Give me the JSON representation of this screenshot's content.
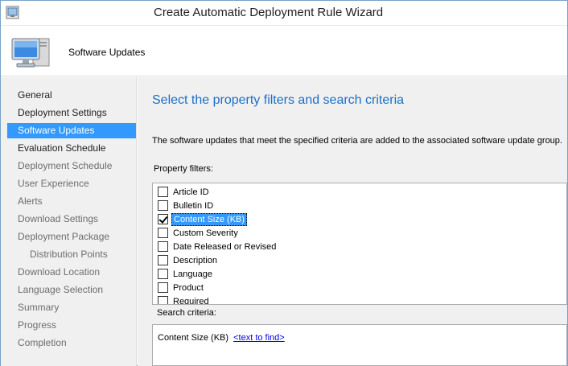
{
  "window": {
    "title": "Create Automatic Deployment Rule Wizard"
  },
  "header": {
    "title": "Software Updates",
    "icon": "computer-monitor-icon"
  },
  "sidebar": {
    "items": [
      {
        "label": "General",
        "state": "done"
      },
      {
        "label": "Deployment Settings",
        "state": "done"
      },
      {
        "label": "Software Updates",
        "state": "active"
      },
      {
        "label": "Evaluation Schedule",
        "state": "done"
      },
      {
        "label": "Deployment Schedule",
        "state": "pending"
      },
      {
        "label": "User Experience",
        "state": "pending"
      },
      {
        "label": "Alerts",
        "state": "pending"
      },
      {
        "label": "Download Settings",
        "state": "pending"
      },
      {
        "label": "Deployment Package",
        "state": "pending"
      },
      {
        "label": "Distribution Points",
        "state": "pending",
        "indent": true
      },
      {
        "label": "Download Location",
        "state": "pending"
      },
      {
        "label": "Language Selection",
        "state": "pending"
      },
      {
        "label": "Summary",
        "state": "pending"
      },
      {
        "label": "Progress",
        "state": "pending"
      },
      {
        "label": "Completion",
        "state": "pending"
      }
    ]
  },
  "main": {
    "heading": "Select the property filters and search criteria",
    "description": "The software updates that meet the specified criteria are added to the associated software update group.",
    "property_filters_label": "Property filters:",
    "filters": [
      {
        "label": "Article ID",
        "checked": false,
        "selected": false
      },
      {
        "label": "Bulletin ID",
        "checked": false,
        "selected": false
      },
      {
        "label": "Content Size (KB)",
        "checked": true,
        "selected": true
      },
      {
        "label": "Custom Severity",
        "checked": false,
        "selected": false
      },
      {
        "label": "Date Released or Revised",
        "checked": false,
        "selected": false
      },
      {
        "label": "Description",
        "checked": false,
        "selected": false
      },
      {
        "label": "Language",
        "checked": false,
        "selected": false
      },
      {
        "label": "Product",
        "checked": false,
        "selected": false
      },
      {
        "label": "Required",
        "checked": false,
        "selected": false
      }
    ],
    "search_criteria_label": "Search criteria:",
    "search_criteria": {
      "text": "Content Size (KB)",
      "link": "<text to find>"
    }
  }
}
